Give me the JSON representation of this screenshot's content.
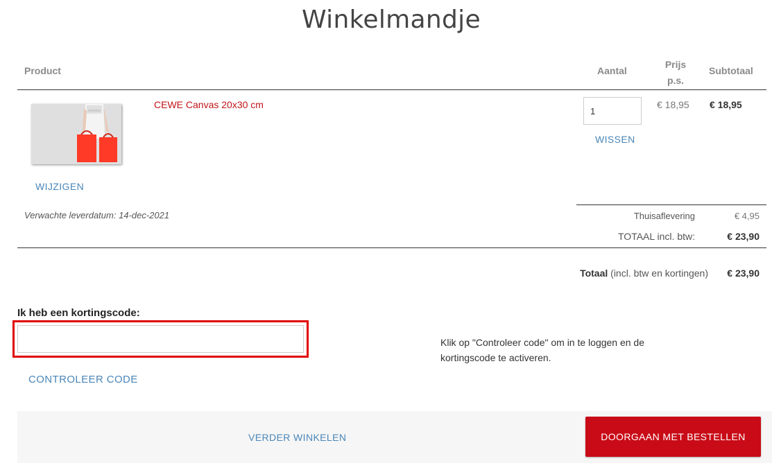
{
  "page": {
    "title": "Winkelmandje"
  },
  "table": {
    "headers": {
      "product": "Product",
      "quantity": "Aantal",
      "price_line1": "Prijs",
      "price_line2": "p.s.",
      "subtotal": "Subtotaal"
    }
  },
  "item": {
    "name": "CEWE Canvas 20x30 cm",
    "quantity": "1",
    "unit_price": "€ 18,95",
    "subtotal": "€ 18,95",
    "edit_label": "WIJZIGEN",
    "remove_label": "WISSEN",
    "thumbnail": "photo-thumbnail"
  },
  "delivery": {
    "expected": "Verwachte leverdatum: 14-dec-2021"
  },
  "summary": {
    "shipping_label": "Thuisaflevering",
    "shipping_value": "€ 4,95",
    "total_label": "TOTAAL incl. btw:",
    "total_value": "€ 23,90",
    "grand_total_bold": "Totaal",
    "grand_total_note": "(incl. btw en kortingen)",
    "grand_total_value": "€ 23,90"
  },
  "coupon": {
    "label": "Ik heb een kortingscode:",
    "value": "",
    "placeholder": "",
    "check_label": "CONTROLEER CODE",
    "info_line1": "Klik op \"Controleer code\" om in te loggen en de",
    "info_line2": "kortingscode te activeren."
  },
  "footer": {
    "continue_label": "VERDER WINKELEN",
    "checkout_label": "DOORGAAN MET BESTELLEN"
  },
  "colors": {
    "accent": "#c90b17",
    "link": "#4a86b8",
    "highlight": "#e00000"
  }
}
